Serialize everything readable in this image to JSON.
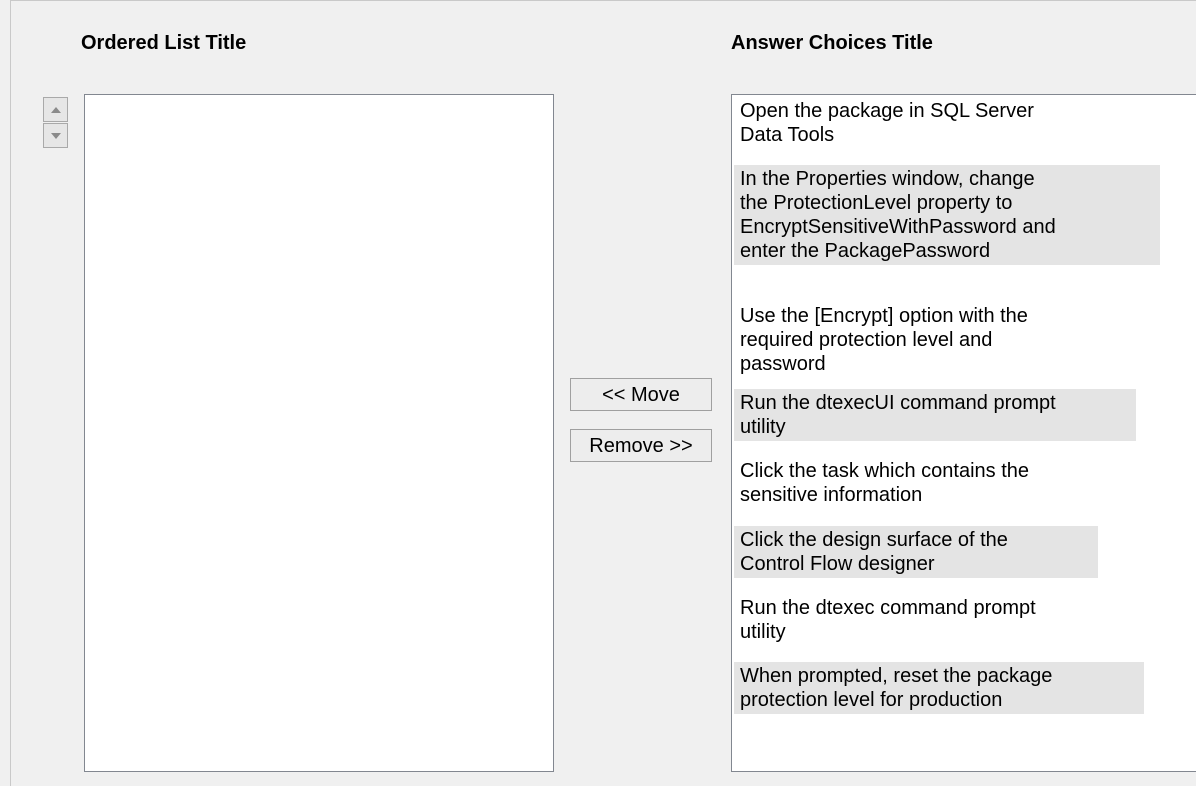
{
  "ordered_list": {
    "title": "Ordered List Title",
    "items": []
  },
  "answer_choices": {
    "title": "Answer Choices Title",
    "items": [
      {
        "line1": "Open the package in SQL Server",
        "line2": "Data Tools"
      },
      {
        "line1": "In the Properties window, change",
        "line2": "the ProtectionLevel property to",
        "line3": "EncryptSensitiveWithPassword and",
        "line4": "enter the PackagePassword"
      },
      {
        "line1": "Use the [Encrypt] option with the",
        "line2": "required protection level and",
        "line3": "password"
      },
      {
        "line1": "Run the dtexecUI command prompt",
        "line2": "utility"
      },
      {
        "line1": "Click the task which contains the",
        "line2": "sensitive information"
      },
      {
        "line1": "Click the design surface of the",
        "line2": "Control Flow designer"
      },
      {
        "line1": "Run the dtexec command prompt",
        "line2": "utility"
      },
      {
        "line1": "When prompted, reset the package",
        "line2": "protection level for production"
      }
    ]
  },
  "buttons": {
    "move_label": "<< Move",
    "remove_label": "Remove >>",
    "up_icon": "triangle-up-icon",
    "down_icon": "triangle-down-icon"
  }
}
